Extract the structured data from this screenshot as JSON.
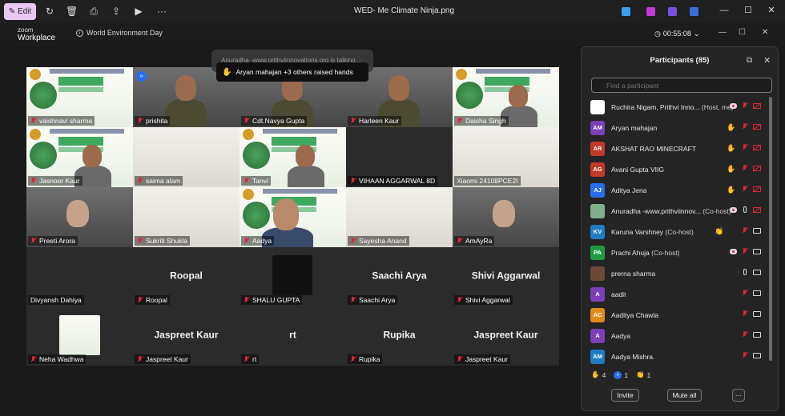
{
  "viewer": {
    "edit_label": "Edit",
    "file_title": "WED- Me Climate Ninja.png"
  },
  "zoom": {
    "logo_top": "zoom",
    "logo_bottom": "Workplace",
    "meeting_name": "World Environment Day",
    "timer": "00:55:08"
  },
  "notifications": {
    "faded": "Anuradha -www.prithviinnovations.org is talking...",
    "raised_hands": "Aryan mahajan +3 others raised hands"
  },
  "tiles": [
    {
      "name": "vaishnavi sharma",
      "muted": true
    },
    {
      "name": "prishita",
      "muted": true
    },
    {
      "name": "Cdt.Navya Gupta",
      "muted": true
    },
    {
      "name": "Harleen Kaur",
      "muted": true
    },
    {
      "name": "Daisha Singh",
      "muted": true
    },
    {
      "name": "Jasnoor Kaur",
      "muted": true
    },
    {
      "name": "saima alam",
      "muted": true
    },
    {
      "name": "Tanvi",
      "muted": true
    },
    {
      "name": "VIHAAN AGGARWAL 8D",
      "muted": true
    },
    {
      "name": "Xiaomi 24108PCE2I",
      "muted": false
    },
    {
      "name": "Preeti Arora",
      "muted": true
    },
    {
      "name": "Sukriti Shukla",
      "muted": true
    },
    {
      "name": "Aadya",
      "muted": true
    },
    {
      "name": "Sayesha Anand",
      "muted": true
    },
    {
      "name": "AmAyRa",
      "muted": true
    },
    {
      "name": "Divyansh Dahiya",
      "muted": false
    },
    {
      "name": "Roopal",
      "muted": true,
      "big": "Roopal"
    },
    {
      "name": "SHALU GUPTA",
      "muted": true
    },
    {
      "name": "Saachi Arya",
      "muted": true,
      "big": "Saachi Arya"
    },
    {
      "name": "Shivi Aggarwal",
      "muted": true,
      "big": "Shivi Aggarwal"
    },
    {
      "name": "Neha Wadhwa",
      "muted": true
    },
    {
      "name": "Jaspreet Kaur",
      "muted": true,
      "big": "Jaspreet Kaur"
    },
    {
      "name": "rt",
      "muted": true,
      "big": "rt"
    },
    {
      "name": "Rupika",
      "muted": true,
      "big": "Rupika"
    },
    {
      "name": "Jaspreet Kaur",
      "muted": true,
      "big": "Jaspreet Kaur"
    }
  ],
  "participants": {
    "title": "Participants (85)",
    "search_placeholder": "Find a participant",
    "list": [
      {
        "initials": "",
        "color": "#ffffff",
        "name": "Ruchira Nigam, Prithvi Inno...",
        "role": "(Host, me)",
        "hand": false,
        "rec": true,
        "mic": "off",
        "cam": "off"
      },
      {
        "initials": "AM",
        "color": "#7b3fb8",
        "name": "Aryan mahajan",
        "role": "",
        "hand": true,
        "rec": false,
        "mic": "off",
        "cam": "off"
      },
      {
        "initials": "AR",
        "color": "#c0392b",
        "name": "AKSHAT RAO MINECRAFT",
        "role": "",
        "hand": true,
        "rec": false,
        "mic": "off",
        "cam": "off"
      },
      {
        "initials": "AG",
        "color": "#c0392b",
        "name": "Avani Gupta VIIG",
        "role": "",
        "hand": true,
        "rec": false,
        "mic": "off",
        "cam": "off"
      },
      {
        "initials": "AJ",
        "color": "#2a6ef0",
        "name": "Aditya Jena",
        "role": "",
        "hand": true,
        "rec": false,
        "mic": "off",
        "cam": "off"
      },
      {
        "initials": "",
        "color": "#7fb08a",
        "name": "Anuradha -www.prithviinnov...",
        "role": "(Co-host)",
        "hand": false,
        "rec": true,
        "mic": "on",
        "cam": "off"
      },
      {
        "initials": "KV",
        "color": "#1f7bc2",
        "name": "Karuna Varshney",
        "role": "(Co-host)",
        "hand": false,
        "clap": true,
        "rec": false,
        "mic": "off",
        "cam": "on"
      },
      {
        "initials": "PA",
        "color": "#1f9a45",
        "name": "Prachi Ahuja",
        "role": "(Co-host)",
        "hand": false,
        "rec": true,
        "mic": "off",
        "cam": "on"
      },
      {
        "initials": "",
        "color": "#6b4a3a",
        "name": "prerna sharma",
        "role": "",
        "hand": false,
        "rec": false,
        "mic": "on",
        "cam": "on"
      },
      {
        "initials": "A",
        "color": "#7b3fb8",
        "name": "aadit",
        "role": "",
        "hand": false,
        "rec": false,
        "mic": "off",
        "cam": "on"
      },
      {
        "initials": "AC",
        "color": "#e08a1e",
        "name": "Aaditya Chawla",
        "role": "",
        "hand": false,
        "rec": false,
        "mic": "off",
        "cam": "on"
      },
      {
        "initials": "A",
        "color": "#7b3fb8",
        "name": "Aadya",
        "role": "",
        "hand": false,
        "rec": false,
        "mic": "off",
        "cam": "on"
      },
      {
        "initials": "AM",
        "color": "#1f7bc2",
        "name": "Aadya Mishra.",
        "role": "",
        "hand": false,
        "rec": false,
        "mic": "off",
        "cam": "on"
      }
    ],
    "reactions": {
      "hands": "4",
      "fast": "1",
      "clap": "1"
    },
    "invite_label": "Invite",
    "mute_all_label": "Mute all",
    "more_label": "···"
  }
}
